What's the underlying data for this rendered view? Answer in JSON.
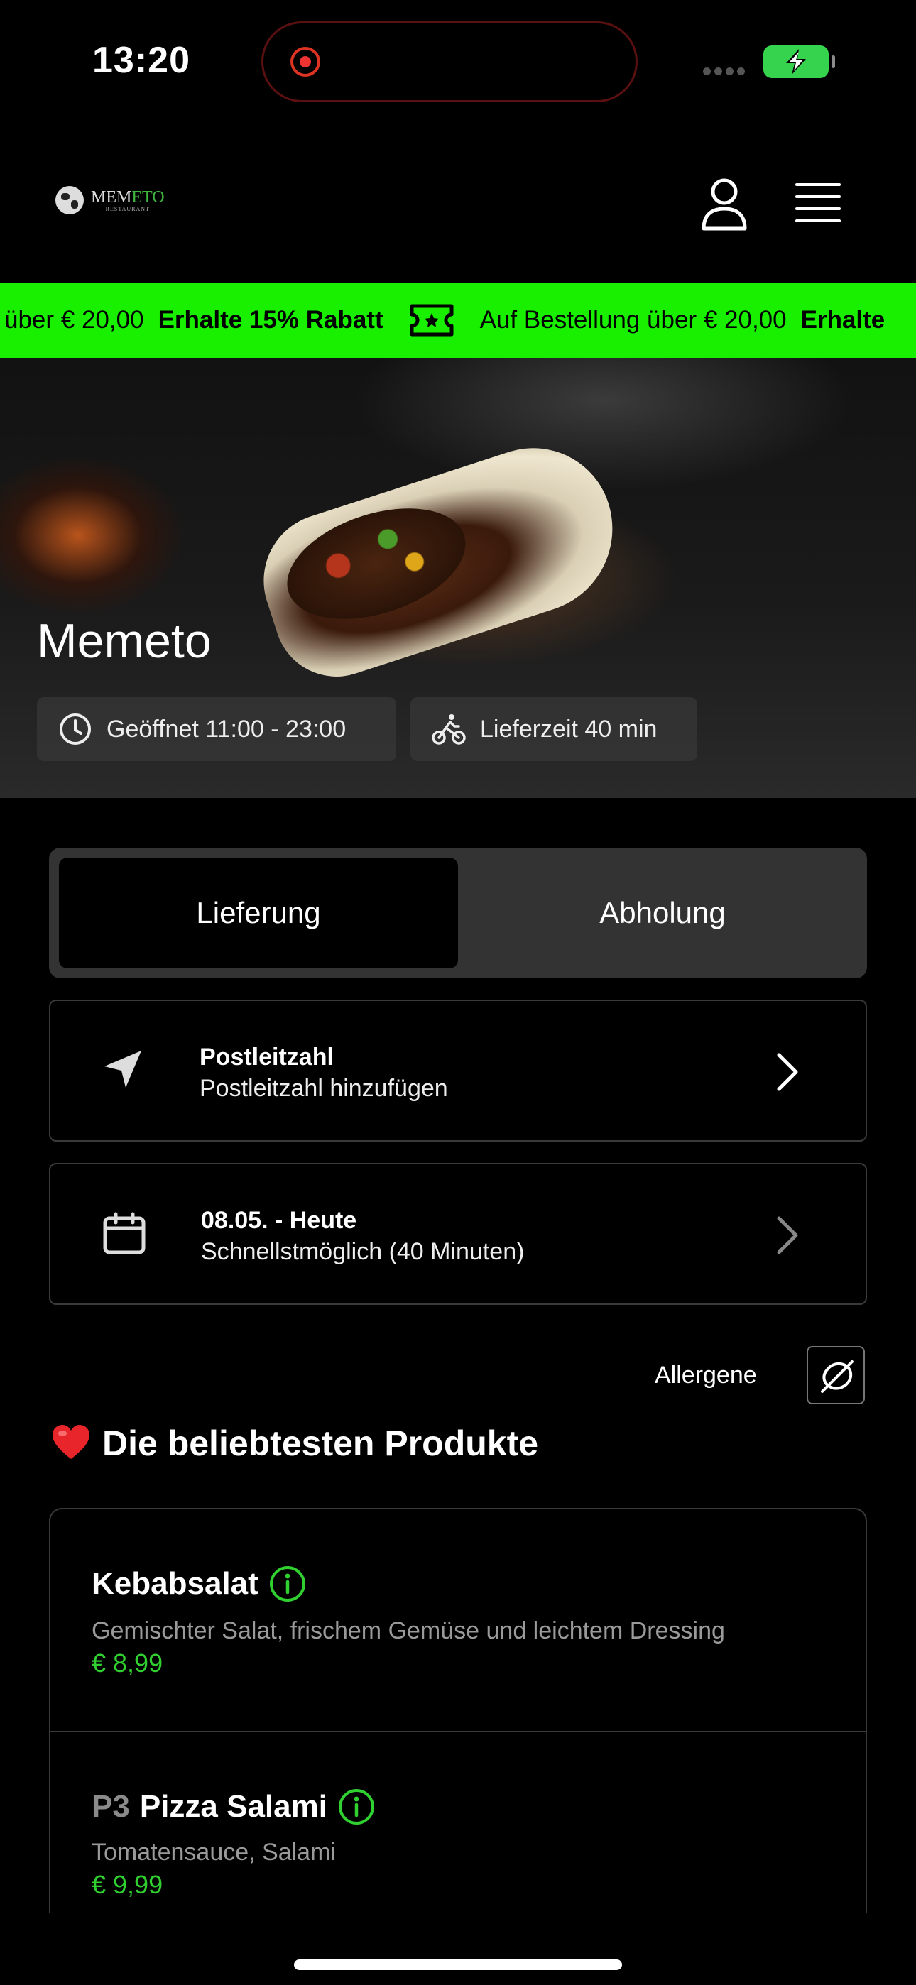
{
  "status_bar": {
    "time": "13:20"
  },
  "header": {
    "logo_text_main": "MEM",
    "logo_text_accent": "ETO",
    "logo_subtext": "RESTAURANT",
    "icons": [
      "user-icon",
      "hamburger-menu-icon"
    ]
  },
  "promo": {
    "text_1": "über € 20,00",
    "bold_1": "Erhalte 15% Rabatt",
    "text_2": "Auf Bestellung über € 20,00",
    "bold_2": "Erhalte",
    "icon": "ticket-icon",
    "background": "#19f000"
  },
  "hero": {
    "title": "Memeto",
    "hours": "Geöffnet 11:00 - 23:00",
    "delivery_time": "Lieferzeit 40 min"
  },
  "order_mode": {
    "options": [
      "Lieferung",
      "Abholung"
    ],
    "selected": "Lieferung"
  },
  "postcode_row": {
    "title": "Postleitzahl",
    "subtitle": "Postleitzahl hinzufügen"
  },
  "time_row": {
    "title": "08.05. - Heute",
    "subtitle": "Schnellstmöglich (40 Minuten)"
  },
  "allergens": {
    "label": "Allergene"
  },
  "popular": {
    "title": "Die beliebtesten Produkte",
    "products": [
      {
        "code": "",
        "name": "Kebabsalat",
        "description": "Gemischter Salat, frischem Gemüse und leichtem Dressing",
        "price": "€ 8,99"
      },
      {
        "code": "P3",
        "name": "Pizza Salami",
        "description": "Tomatensauce, Salami",
        "price": "€ 9,99"
      }
    ]
  },
  "colors": {
    "accent_green": "#2fd02f",
    "banner_green": "#19f000",
    "background": "#000000"
  }
}
